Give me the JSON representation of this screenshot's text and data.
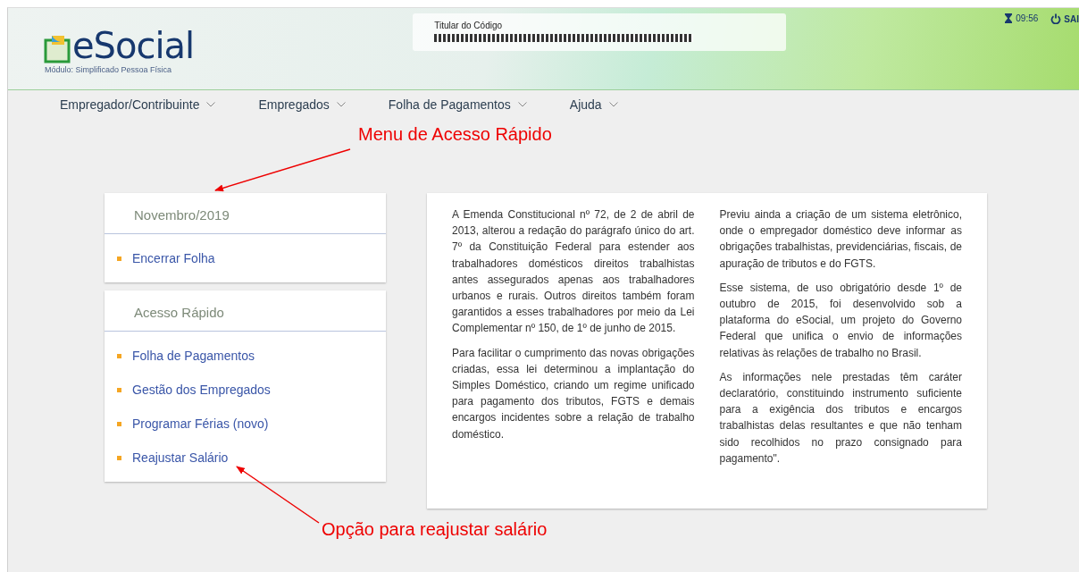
{
  "header": {
    "logo": "eSocial",
    "module": "Módulo: Simplificado Pessoa Física",
    "holder_label": "Titular do Código",
    "timer": "09:56",
    "exit": "SAI"
  },
  "menu": [
    {
      "label": "Empregador/Contribuinte"
    },
    {
      "label": "Empregados"
    },
    {
      "label": "Folha de Pagamentos"
    },
    {
      "label": "Ajuda"
    }
  ],
  "sidebar": [
    {
      "title": "Novembro/2019",
      "items": [
        "Encerrar Folha"
      ]
    },
    {
      "title": "Acesso Rápido",
      "items": [
        "Folha de Pagamentos",
        "Gestão dos Empregados",
        "Programar Férias (novo)",
        "Reajustar Salário"
      ]
    }
  ],
  "info_columns": [
    [
      "A Emenda Constitucional nº 72, de 2 de abril de 2013, alterou a redação do parágrafo único do art. 7º da Constituição Federal para estender aos trabalhadores domésticos direitos trabalhistas antes assegurados apenas aos trabalhadores urbanos e rurais. Outros direitos também foram garantidos a esses trabalhadores por meio da Lei Complementar nº 150, de 1º de junho de 2015.",
      "Para facilitar o cumprimento das novas obrigações criadas, essa lei determinou a implantação do Simples Doméstico, criando um regime unificado para pagamento dos tributos, FGTS e demais encargos incidentes sobre a relação de trabalho doméstico."
    ],
    [
      "Previu ainda a criação de um sistema eletrônico, onde o empregador doméstico deve informar as obrigações trabalhistas, previdenciárias, fiscais, de apuração de tributos e do FGTS.",
      "Esse sistema, de uso obrigatório desde 1º de outubro de 2015, foi desenvolvido sob a plataforma do eSocial, um projeto do Governo Federal que unifica o envio de informações relativas às relações de trabalho no Brasil.",
      "As informações nele prestadas têm caráter declaratório, constituindo instrumento suficiente para a exigência dos tributos e encargos trabalhistas delas resultantes e que não tenham sido recolhidos no prazo consignado para pagamento\"."
    ]
  ],
  "annotations": [
    {
      "text": "Menu de Acesso Rápido"
    },
    {
      "text": "Opção para reajustar salário"
    }
  ]
}
